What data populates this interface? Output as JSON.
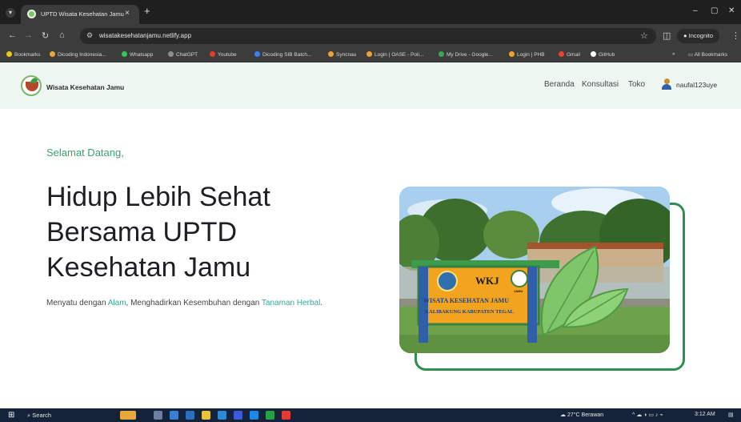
{
  "browser": {
    "tab_title": "UPTD Wisata Kesehatan Jamu",
    "tab_close": "×",
    "new_tab": "+",
    "menu_glyph": "▾",
    "window_controls": [
      "–",
      "▢",
      "✕"
    ],
    "url": "wisatakesehatanjamu.netlify.app",
    "incognito_label": "Incognito",
    "bookmarks": [
      {
        "label": "Bookmarks",
        "color": "#f0c419"
      },
      {
        "label": "Dicoding Indonesia...",
        "color": "#e9a93a"
      },
      {
        "label": "Whatsapp",
        "color": "#34c759"
      },
      {
        "label": "ChatGPT",
        "color": "#8e8e8e"
      },
      {
        "label": "Youtube",
        "color": "#e33b2e"
      },
      {
        "label": "Dicoding SIB Batch...",
        "color": "#3b82f6"
      },
      {
        "label": "Syncnau",
        "color": "#f0a23a"
      },
      {
        "label": "Login | OASE - Poli...",
        "color": "#f0a23a"
      },
      {
        "label": "My Drive - Google...",
        "color": "#34a853"
      },
      {
        "label": "Login | PHB",
        "color": "#f0a23a"
      },
      {
        "label": "Gmail",
        "color": "#ea4335"
      },
      {
        "label": "GitHub",
        "color": "#ffffff"
      }
    ],
    "all_bookmarks": "All Bookmarks"
  },
  "site": {
    "brand": "Wisata Kesehatan Jamu",
    "nav": [
      "Beranda",
      "Konsultasi",
      "Toko"
    ],
    "username": "naufal123uye"
  },
  "hero": {
    "greeting": "Selamat Datang,",
    "headline_lines": [
      "Hidup Lebih Sehat",
      "Bersama UPTD",
      "Kesehatan Jamu"
    ],
    "tagline_prefix": "Menyatu dengan ",
    "tagline_hl1": "Alam",
    "tagline_mid": ", Menghadirkan Kesembuhan dengan ",
    "tagline_hl2": "Tanaman Herbal",
    "tagline_suffix": "."
  },
  "photo_sign": {
    "line1": "WKJ",
    "line2": "WISATA KESEHATAN JAMU",
    "line3": "KALIBAKUNG KABUPATEN TEGAL",
    "badge": "JAMU"
  },
  "taskbar": {
    "start_glyph": "⊞",
    "search_label": "Search",
    "weather": "27°C Berawan",
    "time": "3:12 AM"
  },
  "colors": {
    "accent_green": "#3aa36b",
    "teal_highlight": "#36a89c",
    "frame_green": "#2f8f4e"
  }
}
